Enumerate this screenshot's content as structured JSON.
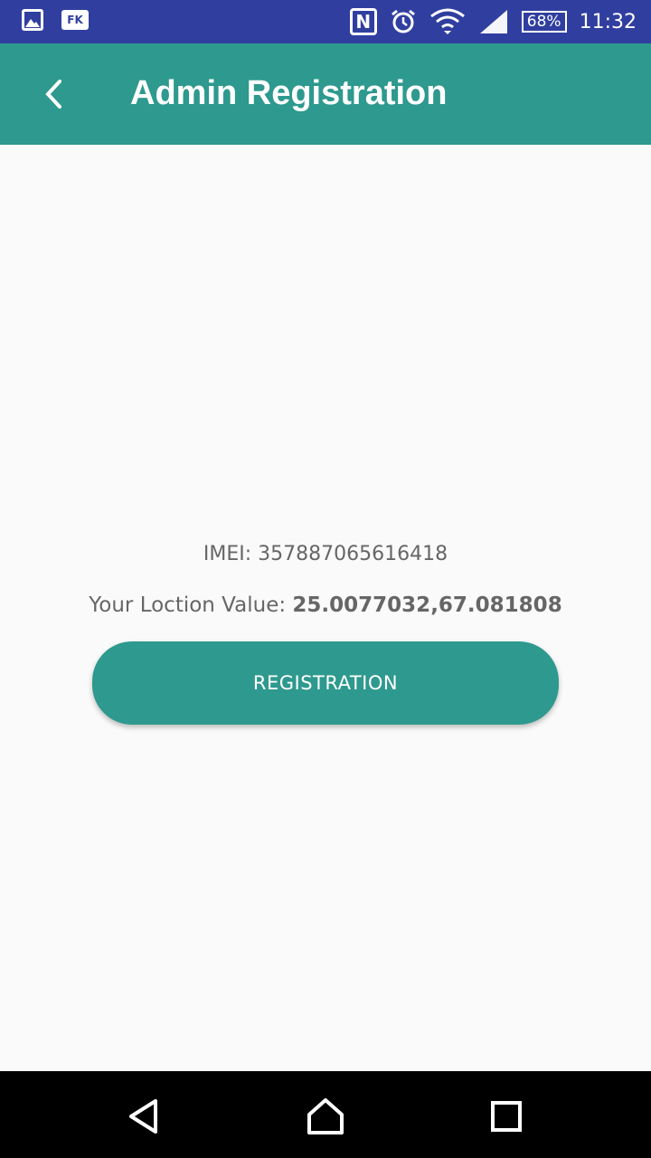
{
  "status_bar": {
    "left_icons": [
      "gallery-icon",
      "fk-icon"
    ],
    "fk_label": "FK",
    "nfc_label": "N",
    "battery": "68%",
    "time": "11:32"
  },
  "app_bar": {
    "title": "Admin Registration"
  },
  "main": {
    "imei_label": "IMEI: 357887065616418",
    "location_label": "Your Loction Value: ",
    "location_value": "25.0077032,67.081808",
    "register_button": "REGISTRATION"
  },
  "colors": {
    "status_bar": "#303f9f",
    "primary": "#2e998e",
    "background": "#fafafa"
  }
}
